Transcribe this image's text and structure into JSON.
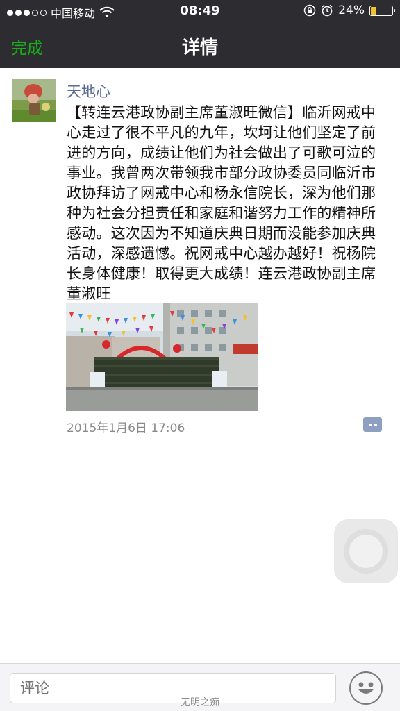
{
  "status_bar": {
    "carrier": "中国移动",
    "time": "08:49",
    "battery_percent": "24%",
    "battery_level": 0.24
  },
  "nav": {
    "back_label": "完成",
    "title": "详情"
  },
  "post": {
    "author": "天地心",
    "text": "【转连云港政协副主席董淑旺微信】临沂网戒中心走过了很不平凡的九年，坎坷让他们坚定了前进的方向，成绩让他们为社会做出了可歌可泣的事业。我曾两次带领我市部分政协委员同临沂市政协拜访了网戒中心和杨永信院长，深为他们那种为社会分担责任和家庭和谐努力工作的精神所感动。这次因为不知道庆典日期而没能参加庆典活动，深感遗憾。祝网戒中心越办越好！祝杨院长身体健康！取得更大成绩！连云港政协副主席董淑旺",
    "timestamp": "2015年1月6日 17:06"
  },
  "comment_bar": {
    "placeholder": "评论"
  },
  "watermark": "无明之痴",
  "colors": {
    "nav_bg": "#2d2d31",
    "accent_green": "#1aad19",
    "author_blue": "#576b95"
  },
  "icons": {
    "wifi": "wifi-icon",
    "lock": "rotation-lock-icon",
    "alarm": "alarm-icon",
    "comment": "comment-icon",
    "emoji": "emoji-icon"
  }
}
